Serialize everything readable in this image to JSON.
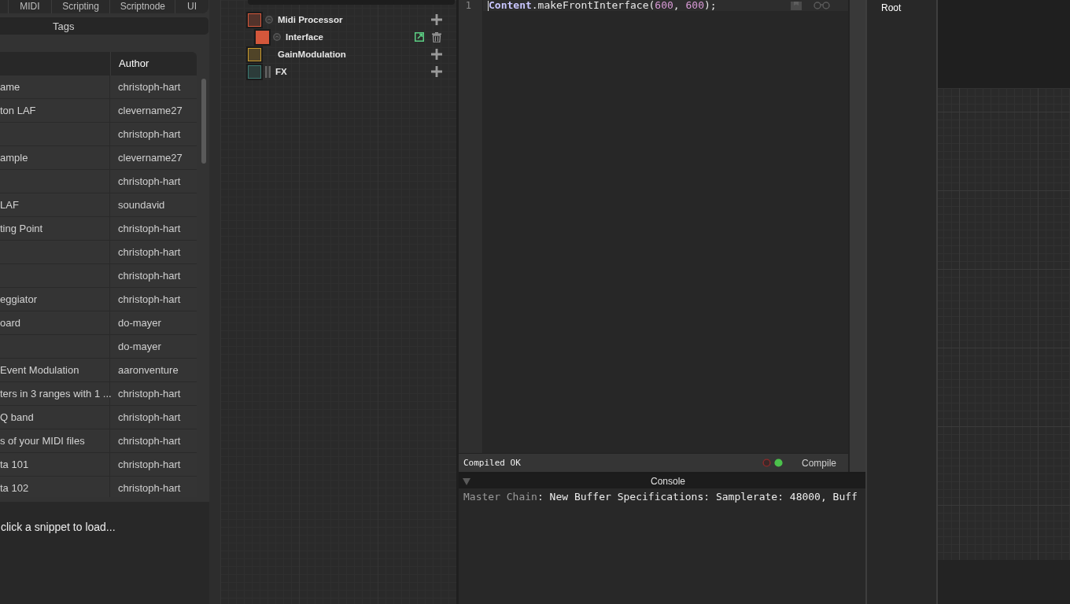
{
  "snippet_browser": {
    "tabs": [
      {
        "label": "MIDI",
        "selected": false
      },
      {
        "label": "Scripting",
        "selected": false
      },
      {
        "label": "Scriptnode",
        "selected": false
      },
      {
        "label": "UI",
        "selected": false
      }
    ],
    "tags_button": "Tags",
    "table": {
      "author_heading": "Author",
      "rows": [
        {
          "column_1": "ame",
          "author": "christoph-hart"
        },
        {
          "column_1": "ton LAF",
          "author": "clevername27"
        },
        {
          "author": "christoph-hart"
        },
        {
          "column_1": "ample",
          "author": "clevername27"
        },
        {
          "author": "christoph-hart"
        },
        {
          "column_1": "LAF",
          "author": "soundavid"
        },
        {
          "column_1": "ting Point",
          "author": "christoph-hart"
        },
        {
          "author": "christoph-hart"
        },
        {
          "author": "christoph-hart"
        },
        {
          "column_1": "eggiator",
          "author": "christoph-hart"
        },
        {
          "column_1": "oard",
          "author": "do-mayer"
        },
        {
          "author": "do-mayer"
        },
        {
          "column_1": "Event Modulation",
          "author": "aaronventure"
        },
        {
          "column_1": "ters in 3 ranges with 1 ...",
          "author": "christoph-hart"
        },
        {
          "column_1": "Q band",
          "author": "christoph-hart"
        },
        {
          "column_1": "s of your MIDI files",
          "author": "christoph-hart"
        },
        {
          "column_1": "ta 101",
          "author": "christoph-hart"
        },
        {
          "column_1": "ta 102",
          "author": "christoph-hart"
        }
      ]
    },
    "hint": "click a snippet to load..."
  },
  "module_tree": {
    "items": [
      {
        "label": "Midi Processor",
        "kind": "processor",
        "color": "#d4573b",
        "selected": false,
        "children": [
          {
            "label": "Interface",
            "kind": "script",
            "color": "#d4573b",
            "selected": true
          }
        ]
      },
      {
        "label": "GainModulation",
        "kind": "modulation",
        "color": "#c99a2e",
        "selected": false
      },
      {
        "label": "FX",
        "kind": "effects",
        "color": "#3c7a72",
        "selected": false
      }
    ]
  },
  "script_editor": {
    "line_numbers": [
      "1"
    ],
    "code": [
      {
        "kind": "keyword",
        "text": "Content"
      },
      {
        "kind": "plain",
        "text": ".makeFrontInterface("
      },
      {
        "kind": "number",
        "text": "600"
      },
      {
        "kind": "plain",
        "text": ", "
      },
      {
        "kind": "number",
        "text": "600"
      },
      {
        "kind": "plain",
        "text": ");"
      }
    ],
    "status": "Compiled OK",
    "indicators": [
      {
        "color": "#8c2a2a",
        "on": false
      },
      {
        "color": "#4cc24c",
        "on": true
      }
    ],
    "compile_button": "Compile"
  },
  "console": {
    "title": "Console",
    "expanded": true,
    "lines": [
      {
        "source": "Master Chain",
        "text": ": New Buffer Specifications: Samplerate: 48000, Buff"
      }
    ]
  },
  "component_tree": {
    "root": "Root"
  }
}
